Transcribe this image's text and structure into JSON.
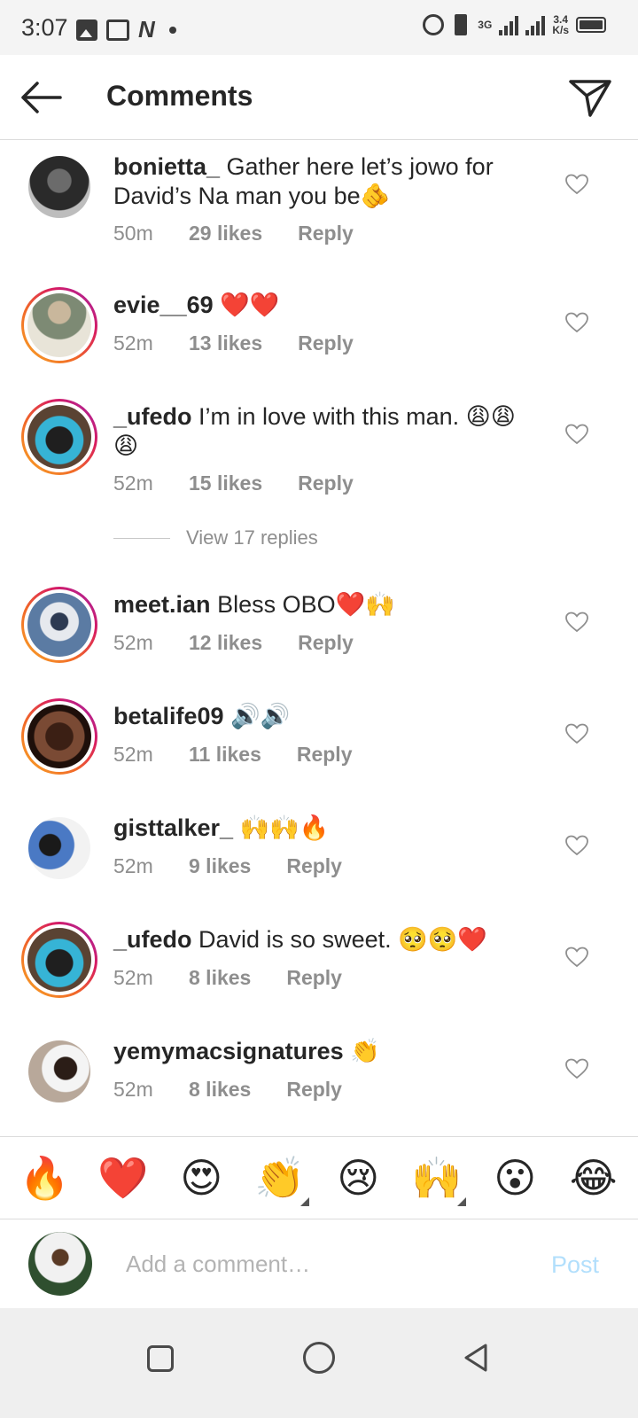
{
  "status_bar": {
    "time": "3:07",
    "network_speed_top": "3.4",
    "network_speed_bottom": "K/s",
    "network_type": "3G"
  },
  "header": {
    "title": "Comments",
    "back_icon": "arrow-left-icon",
    "share_icon": "paper-plane-icon"
  },
  "comments": [
    {
      "username": "bonietta_",
      "text": "Gather here let’s jowo for David’s Na man you be🫵",
      "time": "50m",
      "likes": "29 likes",
      "reply": "Reply"
    },
    {
      "username": "evie__69",
      "text": "❤️❤️",
      "time": "52m",
      "likes": "13 likes",
      "reply": "Reply"
    },
    {
      "username": "_ufedo",
      "text": "I’m in love with this man. 😩😩😩",
      "time": "52m",
      "likes": "15 likes",
      "reply": "Reply"
    },
    {
      "username": "meet.ian",
      "text": "Bless OBO❤️🙌",
      "time": "52m",
      "likes": "12 likes",
      "reply": "Reply"
    },
    {
      "username": "betalife09",
      "text": "🔊🔊",
      "time": "52m",
      "likes": "11 likes",
      "reply": "Reply"
    },
    {
      "username": "gisttalker_",
      "text": "🙌🙌🔥",
      "time": "52m",
      "likes": "9 likes",
      "reply": "Reply"
    },
    {
      "username": "_ufedo",
      "text": "David is so sweet. 🥺🥺❤️",
      "time": "52m",
      "likes": "8 likes",
      "reply": "Reply"
    },
    {
      "username": "yemymacsignatures",
      "text": "👏",
      "time": "52m",
      "likes": "8 likes",
      "reply": "Reply"
    }
  ],
  "view_replies": "View 17 replies",
  "emoji_bar": [
    "🔥",
    "❤️",
    "😍",
    "👏",
    "😢",
    "🙌",
    "😮",
    "😂"
  ],
  "comment_input": {
    "placeholder": "Add a comment…",
    "post_label": "Post"
  },
  "colors": {
    "ring_gradient_start": "#f9a825",
    "ring_gradient_end": "#9c27b0",
    "post_disabled": "#b2dffc",
    "meta_gray": "#8e8e8e"
  }
}
